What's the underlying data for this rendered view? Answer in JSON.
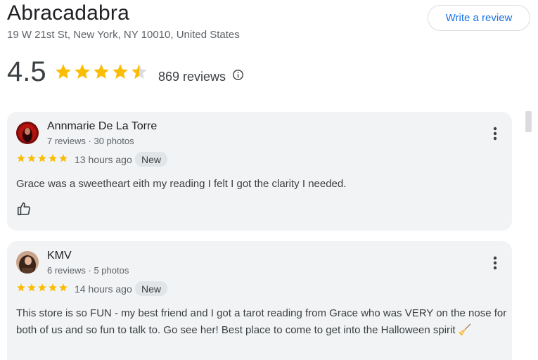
{
  "place": {
    "name": "Abracadabra",
    "address": "19 W 21st St, New York, NY 10010, United States",
    "rating": "4.5",
    "rating_value": 4.5,
    "review_count": "869 reviews",
    "write_review_label": "Write a review"
  },
  "colors": {
    "star": "#fbbc04",
    "star_empty": "#dadce0",
    "link": "#1a73e8",
    "card_bg": "#f1f3f4"
  },
  "reviews": [
    {
      "author": "Annmarie De La Torre",
      "meta": "7 reviews · 30 photos",
      "stars": 5,
      "time": "13 hours ago",
      "badge": "New",
      "text": "Grace was a sweetheart eith my reading I felt I got the clarity I needed.",
      "like_icon": "thumbs-up-icon",
      "more_icon": "more-vert-icon"
    },
    {
      "author": "KMV",
      "meta": "6 reviews · 5 photos",
      "stars": 5,
      "time": "14 hours ago",
      "badge": "New",
      "text": "This store is so FUN - my best friend and I got a tarot reading from Grace who was VERY on the nose for both of us and so fun to talk to. Go see her! Best place to come to get into the Halloween spirit 🧹",
      "more_icon": "more-vert-icon"
    }
  ]
}
